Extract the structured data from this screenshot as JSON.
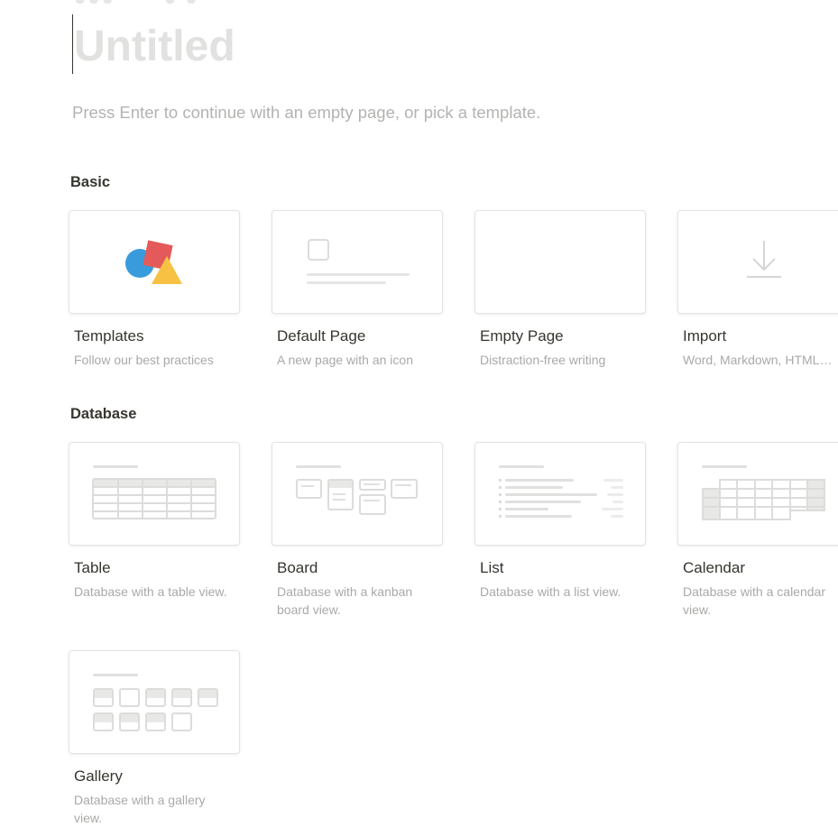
{
  "page": {
    "title_placeholder": "Untitled",
    "hint": "Press Enter to continue with an empty page, or pick a template."
  },
  "sections": {
    "basic": "Basic",
    "database": "Database"
  },
  "basic_templates": [
    {
      "name": "Templates",
      "desc": "Follow our best practices",
      "icon": "shapes-icon"
    },
    {
      "name": "Default Page",
      "desc": "A new page with an icon",
      "icon": "page-outline-icon"
    },
    {
      "name": "Empty Page",
      "desc": "Distraction-free writing",
      "icon": "none"
    },
    {
      "name": "Import",
      "desc": "Word, Markdown, HTML…",
      "icon": "download-arrow-icon"
    }
  ],
  "database_templates": [
    {
      "name": "Table",
      "desc": "Database with a table view.",
      "icon": "table-view-icon"
    },
    {
      "name": "Board",
      "desc": "Database with a kanban board view.",
      "icon": "board-view-icon"
    },
    {
      "name": "List",
      "desc": "Database with a list view.",
      "icon": "list-view-icon"
    },
    {
      "name": "Calendar",
      "desc": "Database with a calendar view.",
      "icon": "calendar-view-icon"
    },
    {
      "name": "Gallery",
      "desc": "Database with a gallery view.",
      "icon": "gallery-view-icon"
    }
  ],
  "colors": {
    "text": "#37352f",
    "muted": "#a9a9a7",
    "placeholder": "#e1e1e0",
    "shape_red": "#e45a5a",
    "shape_blue": "#3a9bdc",
    "shape_yellow": "#f7c244"
  }
}
